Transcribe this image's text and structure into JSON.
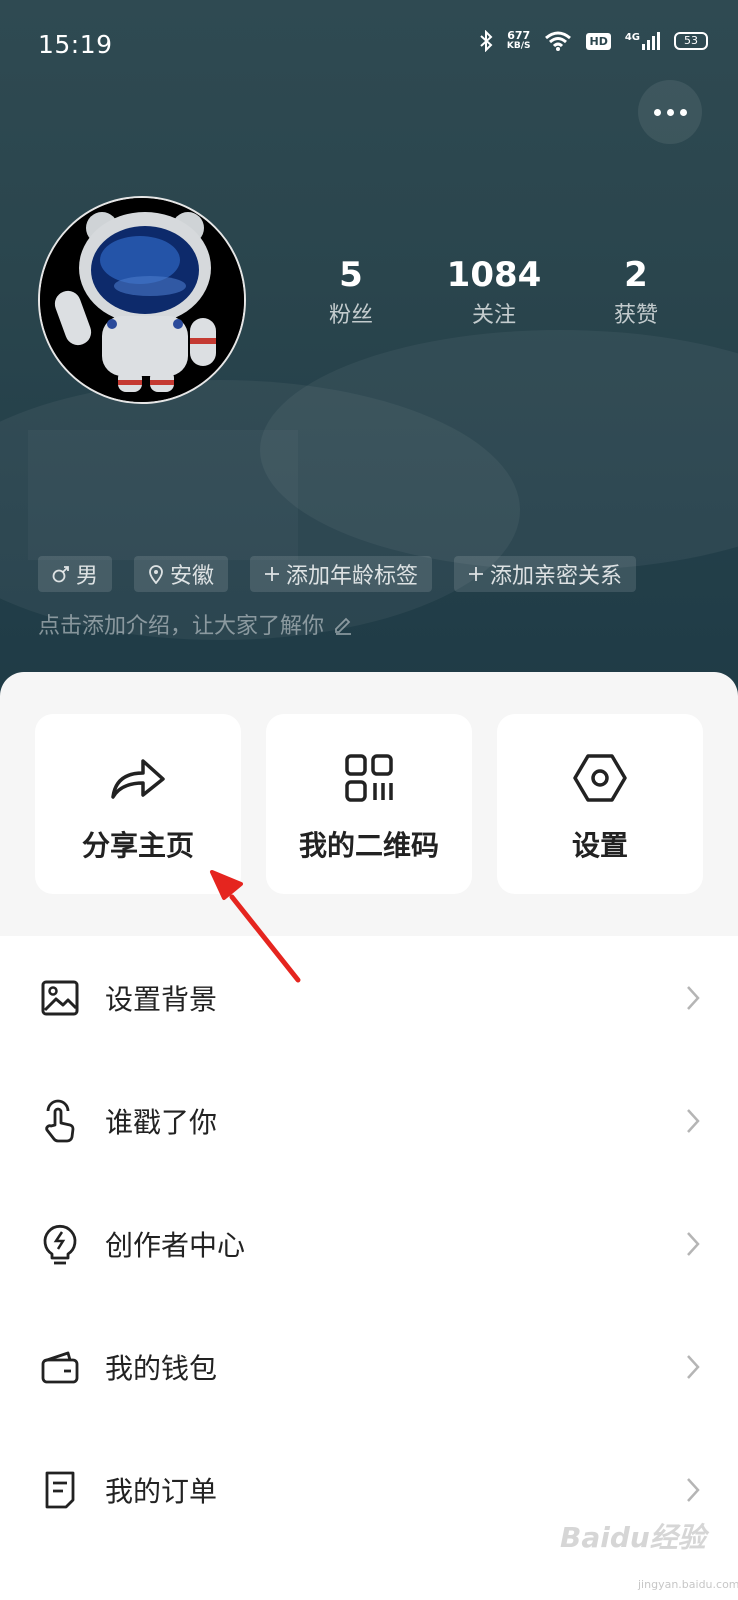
{
  "status_bar": {
    "time": "15:19",
    "net_speed": "677",
    "net_unit": "KB/S",
    "hd": "HD",
    "network": "4G",
    "battery": "53"
  },
  "profile": {
    "stats": [
      {
        "value": "5",
        "label": "粉丝"
      },
      {
        "value": "1084",
        "label": "关注"
      },
      {
        "value": "2",
        "label": "获赞"
      }
    ],
    "tags": [
      {
        "icon": "male-icon",
        "label": "男"
      },
      {
        "icon": "location-icon",
        "label": "安徽"
      },
      {
        "icon": "plus-icon",
        "label": "添加年龄标签"
      },
      {
        "icon": "plus-icon",
        "label": "添加亲密关系"
      }
    ],
    "intro": "点击添加介绍，让大家了解你"
  },
  "quick_actions": [
    {
      "icon": "share-icon",
      "label": "分享主页"
    },
    {
      "icon": "qr-code-icon",
      "label": "我的二维码"
    },
    {
      "icon": "settings-hexagon-icon",
      "label": "设置"
    }
  ],
  "menu": [
    {
      "icon": "image-icon",
      "label": "设置背景"
    },
    {
      "icon": "tap-hand-icon",
      "label": "谁戳了你"
    },
    {
      "icon": "lightbulb-icon",
      "label": "创作者中心"
    },
    {
      "icon": "wallet-icon",
      "label": "我的钱包"
    },
    {
      "icon": "order-icon",
      "label": "我的订单"
    }
  ],
  "watermark": {
    "brand": "Baidu经验",
    "domain": "jingyan.baidu.com"
  },
  "colors": {
    "header_bg": "#2a454d",
    "annotation_arrow": "#e5251f"
  }
}
